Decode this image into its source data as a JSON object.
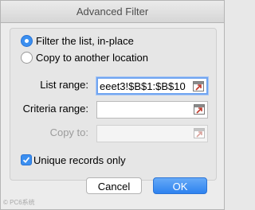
{
  "window": {
    "title": "Advanced Filter"
  },
  "action": {
    "options": [
      {
        "label": "Filter the list, in-place",
        "selected": true
      },
      {
        "label": "Copy to another location",
        "selected": false
      }
    ]
  },
  "fields": {
    "list_range": {
      "label": "List range:",
      "value": "eeet3!$B$1:$B$10"
    },
    "criteria_range": {
      "label": "Criteria range:",
      "value": ""
    },
    "copy_to": {
      "label": "Copy to:",
      "value": ""
    }
  },
  "unique": {
    "label": "Unique records only",
    "checked": true
  },
  "buttons": {
    "cancel": "Cancel",
    "ok": "OK"
  },
  "watermark": "© PC6系统",
  "colors": {
    "accent": "#3b8ff0"
  },
  "icons": {
    "range_picker": "collapse-dialog-icon",
    "check": "checkmark-icon"
  }
}
